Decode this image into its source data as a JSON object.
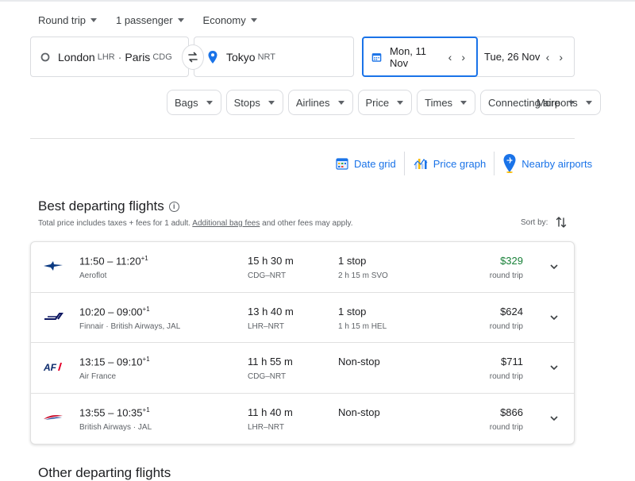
{
  "top": {
    "trip_type": "Round trip",
    "passengers": "1 passenger",
    "cabin": "Economy"
  },
  "search": {
    "origin_city1": "London",
    "origin_code1": "LHR",
    "origin_city2": "Paris",
    "origin_code2": "CDG",
    "dest_city": "Tokyo",
    "dest_code": "NRT",
    "depart_date": "Mon, 11 Nov",
    "return_date": "Tue, 26 Nov"
  },
  "filters": [
    "Bags",
    "Stops",
    "Airlines",
    "Price",
    "Times",
    "Connecting airports"
  ],
  "more_label": "More",
  "tools": {
    "date_grid": "Date grid",
    "price_graph": "Price graph",
    "nearby_airports": "Nearby airports"
  },
  "best": {
    "title": "Best departing flights",
    "subtitle_pre": "Total price includes taxes + fees for 1 adult.",
    "subtitle_link": "Additional bag fees",
    "subtitle_post": "and other fees may apply.",
    "sort_label": "Sort by:"
  },
  "flights": [
    {
      "times": "11:50 – 11:20",
      "plus": "+1",
      "airline": "Aeroflot",
      "duration": "15 h 30 m",
      "route": "CDG–NRT",
      "stops": "1 stop",
      "stop_info": "2 h 15 m SVO",
      "price": "$329",
      "price_type": "round trip"
    },
    {
      "times": "10:20 – 09:00",
      "plus": "+1",
      "airline": "Finnair · British Airways, JAL",
      "duration": "13 h 40 m",
      "route": "LHR–NRT",
      "stops": "1 stop",
      "stop_info": "1 h 15 m HEL",
      "price": "$624",
      "price_type": "round trip"
    },
    {
      "times": "13:15 – 09:10",
      "plus": "+1",
      "airline": "Air France",
      "duration": "11 h 55 m",
      "route": "CDG–NRT",
      "stops": "Non-stop",
      "stop_info": "",
      "price": "$711",
      "price_type": "round trip"
    },
    {
      "times": "13:55 – 10:35",
      "plus": "+1",
      "airline": "British Airways · JAL",
      "duration": "11 h 40 m",
      "route": "LHR–NRT",
      "stops": "Non-stop",
      "stop_info": "",
      "price": "$866",
      "price_type": "round trip"
    }
  ],
  "other": {
    "title": "Other departing flights"
  },
  "colors": {
    "accent": "#1a73e8",
    "price_good": "#188038"
  },
  "icons": [
    "chevron-down-icon",
    "swap-icon",
    "location-pin-icon",
    "calendar-icon",
    "info-icon",
    "sort-icon"
  ]
}
